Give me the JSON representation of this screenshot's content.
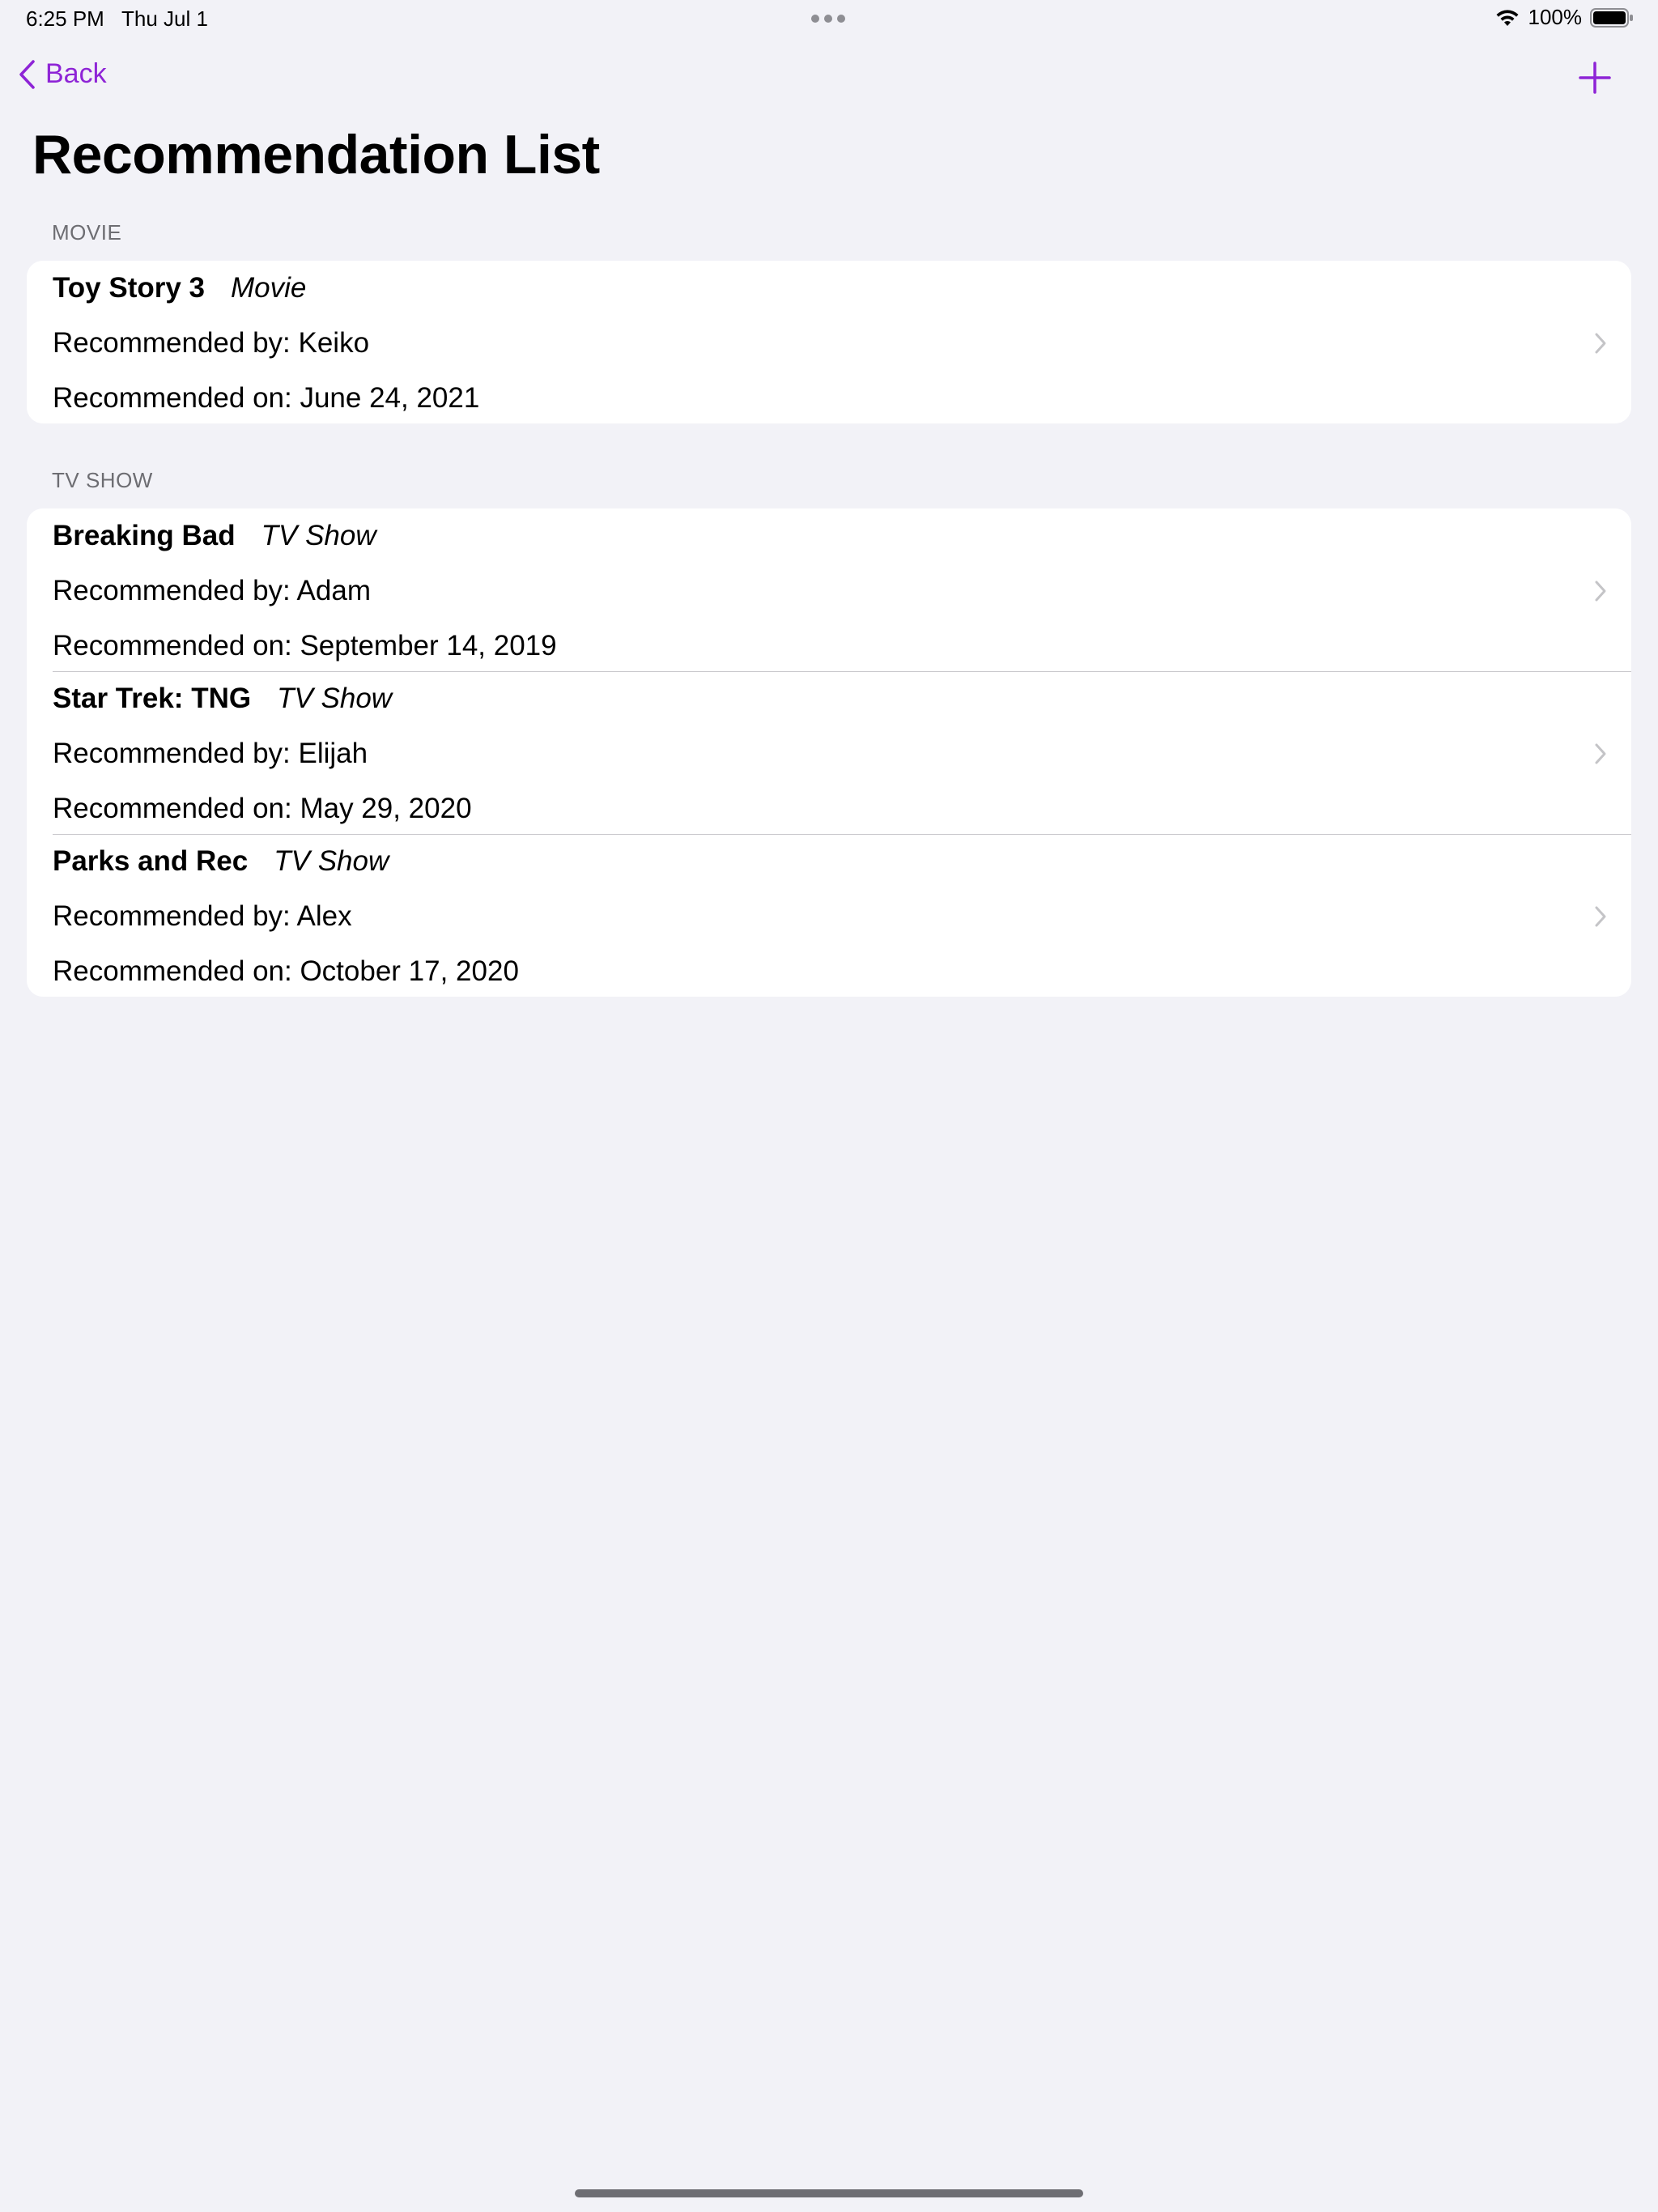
{
  "status_bar": {
    "time": "6:25 PM",
    "date": "Thu Jul 1",
    "battery": "100%"
  },
  "nav": {
    "back_label": "Back"
  },
  "page_title": "Recommendation List",
  "accent_color": "#8e24d6",
  "sections": [
    {
      "header": "MOVIE",
      "items": [
        {
          "title": "Toy Story 3",
          "type": "Movie",
          "recommended_by": "Recommended by: Keiko",
          "recommended_on": "Recommended on: June 24, 2021"
        }
      ]
    },
    {
      "header": "TV SHOW",
      "items": [
        {
          "title": "Breaking Bad",
          "type": "TV Show",
          "recommended_by": "Recommended by: Adam",
          "recommended_on": "Recommended on: September 14, 2019"
        },
        {
          "title": "Star Trek: TNG",
          "type": "TV Show",
          "recommended_by": "Recommended by: Elijah",
          "recommended_on": "Recommended on: May 29, 2020"
        },
        {
          "title": "Parks and Rec",
          "type": "TV Show",
          "recommended_by": "Recommended by: Alex",
          "recommended_on": "Recommended on: October 17, 2020"
        }
      ]
    }
  ]
}
